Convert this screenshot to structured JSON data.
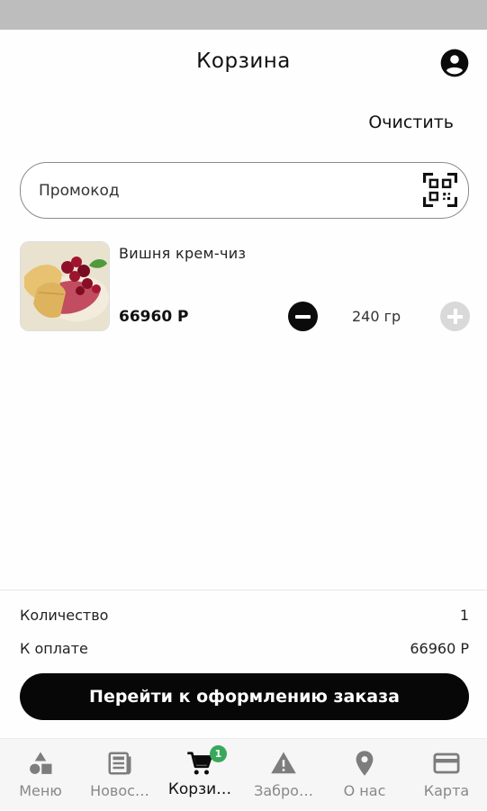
{
  "header": {
    "title": "Корзина",
    "profile_icon": "account-circle-icon"
  },
  "actions": {
    "clear_label": "Очистить"
  },
  "promo": {
    "placeholder": "Промокод",
    "value": "",
    "scan_icon": "qr-code-scan-icon"
  },
  "cart": {
    "items": [
      {
        "name": "Вишня крем-чиз",
        "price": "66960 Р",
        "weight": "240 гр",
        "image": "crepe-with-cherries-image"
      }
    ]
  },
  "summary": {
    "quantity_label": "Количество",
    "quantity_value": "1",
    "total_label": "К оплате",
    "total_value": "66960 Р"
  },
  "checkout": {
    "label": "Перейти к оформлению заказа"
  },
  "nav": {
    "items": [
      {
        "label": "Меню",
        "icon": "menu-shapes-icon"
      },
      {
        "label": "Новос…",
        "icon": "news-icon"
      },
      {
        "label": "Корзи…",
        "icon": "cart-icon",
        "badge": "1",
        "active": true
      },
      {
        "label": "Забро…",
        "icon": "warning-icon"
      },
      {
        "label": "О нас",
        "icon": "location-pin-icon"
      },
      {
        "label": "Карта",
        "icon": "credit-card-icon"
      }
    ]
  },
  "colors": {
    "accent": "#070707",
    "badge": "#3aa85a",
    "status_bar": "#bdbdbd",
    "inactive": "#888888"
  }
}
